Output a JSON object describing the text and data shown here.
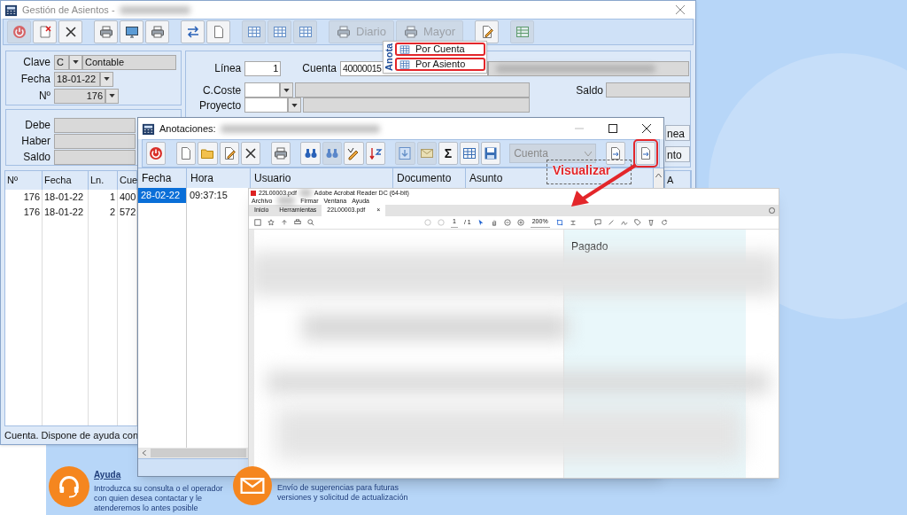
{
  "main_window": {
    "title": "Gestión de Asientos -",
    "toolbar": [
      {
        "disabled": true
      },
      {
        "disabled": false
      },
      {
        "disabled": false
      },
      {
        "disabled": false
      },
      {
        "disabled": false
      },
      {
        "disabled": false
      },
      {
        "disabled": false
      },
      {
        "disabled": false
      },
      {
        "disabled": true
      },
      {
        "disabled": true
      },
      {
        "disabled": true
      },
      {
        "label": "Diario",
        "disabled": true
      },
      {
        "label": "Mayor",
        "disabled": true
      },
      {
        "disabled": false
      },
      {
        "disabled": true
      }
    ],
    "annotations_menu": {
      "header": "Anota",
      "items": [
        {
          "label": "Por Cuenta",
          "highlighted": true
        },
        {
          "label": "Por Asiento",
          "highlighted": true
        }
      ]
    },
    "header_form": {
      "clave": {
        "label": "Clave",
        "code": "C",
        "description": "Contable"
      },
      "fecha": {
        "label": "Fecha",
        "value": "18-01-22"
      },
      "numero": {
        "label": "Nº",
        "value": "176"
      }
    },
    "totals": [
      {
        "label": "Debe"
      },
      {
        "label": "Haber"
      },
      {
        "label": "Saldo"
      }
    ],
    "line_form": {
      "linea": {
        "label": "Línea",
        "value": "1"
      },
      "cuenta": {
        "label": "Cuenta",
        "value": "40000015"
      },
      "coste": {
        "label": "C.Coste"
      },
      "proyecto": {
        "label": "Proyecto"
      },
      "saldo": {
        "label": "Saldo"
      }
    },
    "side_buttons": [
      "nea",
      "nto"
    ],
    "table": {
      "columns": [
        "Nº",
        "Fecha",
        "Ln.",
        "Cue",
        "A"
      ],
      "rows": [
        [
          "176",
          "18-01-22",
          "1",
          "400"
        ],
        [
          "176",
          "18-01-22",
          "2",
          "572"
        ]
      ]
    },
    "status_bar": "Cuenta. Dispone de ayuda con"
  },
  "annotations_window": {
    "title": "Anotaciones:",
    "toolbar": [
      {
        "disabled": false
      },
      {
        "disabled": false
      },
      {
        "disabled": false
      },
      {
        "disabled": false
      },
      {
        "disabled": false
      },
      {
        "disabled": false
      },
      {
        "disabled": false
      },
      {
        "disabled": true
      },
      {
        "disabled": false
      },
      {
        "disabled": false
      },
      {
        "disabled": true
      },
      {
        "disabled": true
      },
      {
        "label": "Σ",
        "disabled": false
      },
      {
        "disabled": false
      },
      {
        "disabled": false
      },
      {
        "disabled": false
      },
      {
        "disabled": false,
        "highlighted": true
      }
    ],
    "filter_combo": {
      "value": "Cuenta",
      "disabled": true
    },
    "grid": {
      "columns": [
        "Fecha",
        "Hora",
        "Usuario",
        "Documento",
        "Asunto"
      ],
      "rows": [
        {
          "cells": [
            "28-02-22",
            "09:37:15"
          ],
          "selected": true
        }
      ]
    }
  },
  "callout": {
    "text": "Visualizar"
  },
  "pdf_viewer": {
    "title_file": "22L00003.pdf",
    "title_app": "Adobe Acrobat Reader DC (64-bit)",
    "menu": [
      "Archivo",
      "Firmar",
      "Ventana",
      "Ayuda"
    ],
    "tabs": [
      {
        "label": "Inicio",
        "selected": false
      },
      {
        "label": "Herramientas",
        "selected": false
      },
      {
        "label": "22L00003.pdf",
        "selected": true
      }
    ],
    "tab_close": "×",
    "page": "1",
    "page_total": "/ 1",
    "zoom": "200%",
    "panel_title": "Pagado"
  },
  "help": [
    {
      "title": "Ayuda",
      "text": "Introduzca su consulta o el operador con quien desea contactar y le atenderemos lo antes posible"
    },
    {
      "text": "Envío de sugerencias para futuras versiones y solicitud de actualización"
    }
  ]
}
